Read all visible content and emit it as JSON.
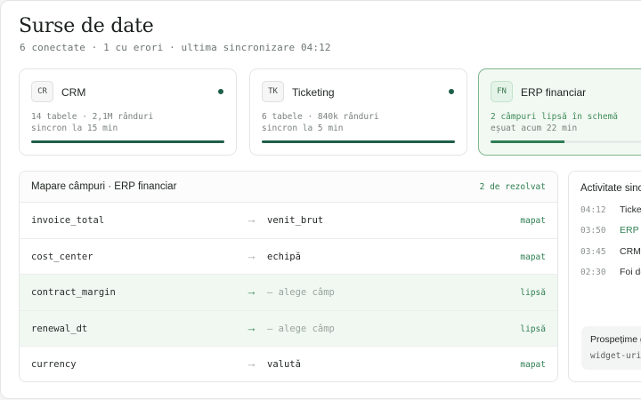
{
  "header": {
    "title": "Surse de date",
    "subtitle": "6 conectate · 1 cu erori · ultima sincronizare 04:12"
  },
  "colors": {
    "accent": "#1f5f4a",
    "ok": "#2f7f51",
    "alert_bg": "#f2f9f3",
    "alert_border": "#7fb88f"
  },
  "sources": [
    {
      "badge": "CR",
      "name": "CRM",
      "meta1": "14 tabele · 2,1M rânduri",
      "meta2": "sincron la 15 min",
      "progress": 1.0,
      "status": "ok"
    },
    {
      "badge": "TK",
      "name": "Ticketing",
      "meta1": "6 tabele · 840k rânduri",
      "meta2": "sincron la 5 min",
      "progress": 1.0,
      "status": "ok"
    },
    {
      "badge": "FN",
      "name": "ERP financiar",
      "meta1": "2 câmpuri lipsă în schemă",
      "meta2": "eșuat acum 22 min",
      "progress": 0.45,
      "status": "error"
    }
  ],
  "mapping": {
    "title": "Mapare câmpuri · ERP financiar",
    "count": "2 de rezolvat",
    "arrow": "→",
    "rows": [
      {
        "source": "invoice_total",
        "target": "venit_brut",
        "status": "mapat",
        "missing": false
      },
      {
        "source": "cost_center",
        "target": "echipă",
        "status": "mapat",
        "missing": false
      },
      {
        "source": "contract_margin",
        "target": "— alege câmp",
        "status": "lipsă",
        "missing": true
      },
      {
        "source": "renewal_dt",
        "target": "— alege câmp",
        "status": "lipsă",
        "missing": true
      },
      {
        "source": "currency",
        "target": "valută",
        "status": "mapat",
        "missing": false
      }
    ]
  },
  "activity": {
    "title": "Activitate sinc",
    "items": [
      {
        "time": "04:12",
        "text": "Ticket",
        "highlight": false
      },
      {
        "time": "03:50",
        "text": "ERP fi",
        "highlight": true
      },
      {
        "time": "03:45",
        "text": "CRM -",
        "highlight": false
      },
      {
        "time": "02:30",
        "text": "Foi de",
        "highlight": false
      }
    ],
    "freshness": {
      "title": "Prospețime g",
      "code": "widget-uril"
    }
  }
}
